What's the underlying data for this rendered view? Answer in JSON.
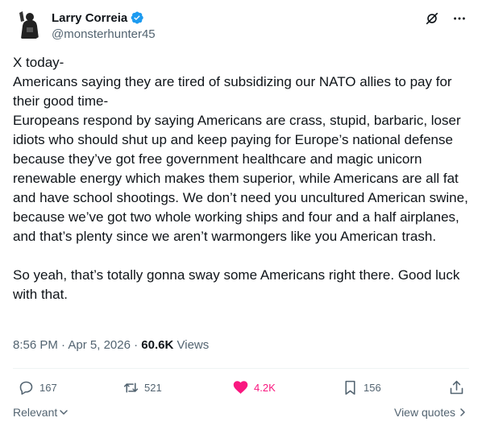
{
  "author": {
    "name": "Larry Correia",
    "handle": "@monsterhunter45"
  },
  "tweet": {
    "paragraphs": [
      "X today-",
      "Americans saying they are tired of subsidizing our NATO allies to pay for their good time-",
      "Europeans respond by saying Americans are crass, stupid, barbaric, loser idiots who should shut up and keep paying for Europe’s national defense because they’ve got free government healthcare and magic unicorn renewable energy which makes them superior, while Americans are all fat and have school shootings. We don’t need you uncultured American swine, because we’ve got two whole working ships and four and a half airplanes, and that’s plenty since we aren’t warmongers like you American trash.",
      "So yeah, that’s totally gonna sway some Americans right there. Good luck with that."
    ]
  },
  "meta": {
    "time": "8:56 PM",
    "separator": " · ",
    "date": "Apr 5, 2026",
    "views_count": "60.6K",
    "views_label": "Views"
  },
  "actions": {
    "replies": "167",
    "reposts": "521",
    "likes": "4.2K",
    "bookmarks": "156"
  },
  "footer": {
    "sort_label": "Relevant",
    "quotes_label": "View quotes"
  },
  "colors": {
    "text": "#0f1419",
    "secondary": "#536471",
    "verified": "#1d9bf0",
    "like": "#f91880"
  }
}
